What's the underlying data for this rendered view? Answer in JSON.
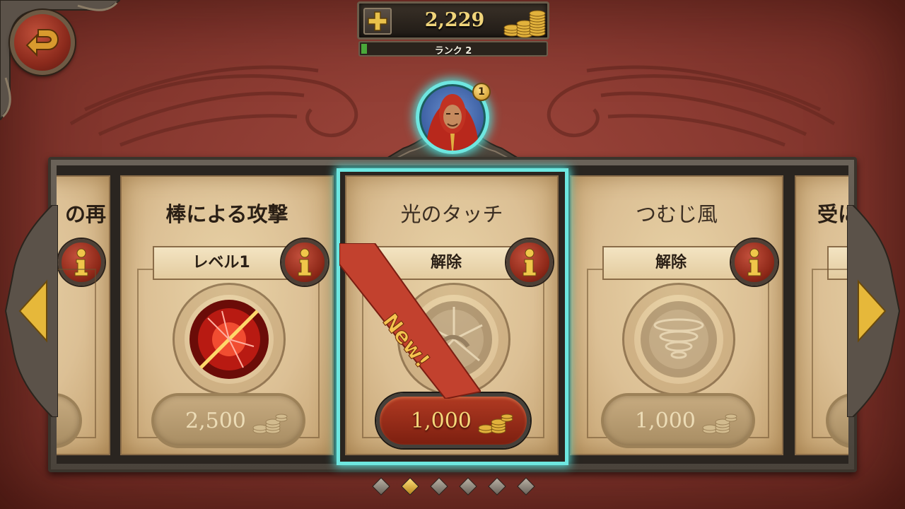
{
  "header": {
    "coins": "2,229",
    "rank_label": "ランク 2",
    "rank_progress": 0.03
  },
  "avatar": {
    "badge_count": "1"
  },
  "cards": [
    {
      "title": "の再",
      "status": "",
      "price": ""
    },
    {
      "title": "棒による攻撃",
      "status": "レベル1",
      "price": "2,500",
      "icon": "staff-strike-icon"
    },
    {
      "title": "光のタッチ",
      "status": "解除",
      "price": "1,000",
      "icon": "light-touch-icon",
      "new_label": "New!",
      "selected": true
    },
    {
      "title": "つむじ風",
      "status": "解除",
      "price": "1,000",
      "icon": "whirlwind-icon"
    },
    {
      "title": "受に",
      "status": "",
      "price": ""
    }
  ],
  "pagination": {
    "pages": 6,
    "active_index": 1
  },
  "colors": {
    "background": "#8a3a31",
    "highlight": "#6ee7e0",
    "gold": "#f0d47a",
    "parchment": "#dcc095"
  }
}
